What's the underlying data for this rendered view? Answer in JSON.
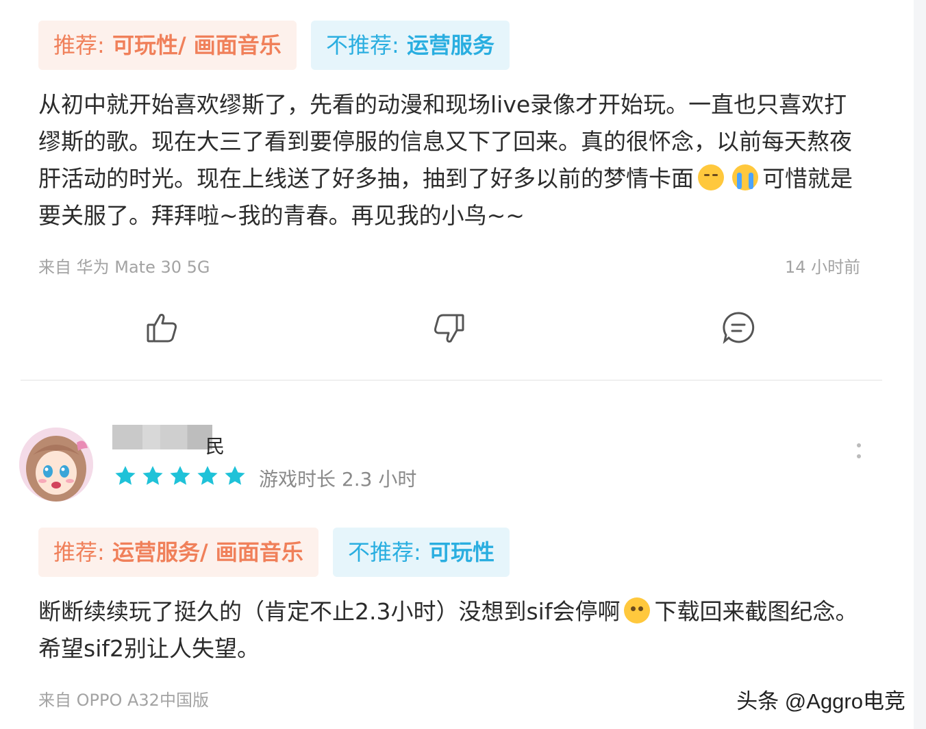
{
  "review1": {
    "tag_rec_prefix": "推荐:",
    "tag_rec_value": "可玩性/ 画面音乐",
    "tag_notrec_prefix": "不推荐:",
    "tag_notrec_value": "运营服务",
    "text_part1": "从初中就开始喜欢缪斯了，先看的动漫和现场live录像才开始玩。一直也只喜欢打缪斯的歌。现在大三了看到要停服的信息又下了回来。真的很怀念，以前每天熬夜肝活动的时光。现在上线送了好多抽，抽到了好多以前的梦情卡面",
    "text_part2": "可惜就是要关服了。拜拜啦~我的青春。再见我的小鸟~~",
    "device": "来自 华为 Mate 30 5G",
    "time": "14 小时前",
    "actions": {
      "like_icon": "thumbs-up-icon",
      "dislike_icon": "thumbs-down-icon",
      "comment_icon": "comment-icon"
    }
  },
  "review2": {
    "username_visible_suffix": "民",
    "rating": 5,
    "playtime": "游戏时长 2.3 小时",
    "tag_rec_prefix": "推荐:",
    "tag_rec_value": "运营服务/ 画面音乐",
    "tag_notrec_prefix": "不推荐:",
    "tag_notrec_value": "可玩性",
    "text_part1": "断断续续玩了挺久的（肯定不止2.3小时）没想到sif会停啊",
    "text_part2": "下载回来截图纪念。希望sif2别让人失望。",
    "device": "来自 OPPO A32中国版"
  },
  "watermark": "头条 @Aggro电竞",
  "colors": {
    "rec": "#f0805a",
    "rec_bg": "#fdf1ec",
    "notrec": "#2aaee0",
    "notrec_bg": "#e6f5fb",
    "star": "#1fc2d8"
  }
}
